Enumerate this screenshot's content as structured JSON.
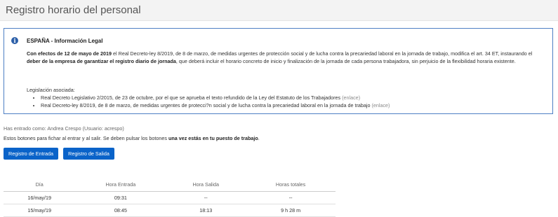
{
  "header": {
    "title": "Registro horario del personal"
  },
  "info": {
    "title": "ESPAÑA - Información Legal",
    "p_bold1": "Con efectos de 12 de mayo de 2019",
    "p_text1": " el Real Decreto-ley 8/2019, de 8 de marzo, de medidas urgentes de protección social y de lucha contra la precariedad laboral en la jornada de trabajo, modifica el art. 34 ET, instaurando el ",
    "p_bold2": "deber de la empresa de garantizar el registro diario de jornada",
    "p_text2": ", que deberá incluir el horario concreto de inicio y finalización de la jornada de cada persona trabajadora, sin perjuicio de la flexibilidad horaria existente.",
    "legislation_label": "Legislación asociada:",
    "legislation": [
      {
        "text": "Real Decreto Legislativo 2/2015, de 23 de octubre, por el que se aprueba el texto refundido de la Ley del Estatuto de los Trabajadores ",
        "link": "(enlace)"
      },
      {
        "text": "Real Decreto-ley 8/2019, de 8 de marzo, de medidas urgentes de protecci?n social y de lucha contra la precariedad laboral en la jornada de trabajo ",
        "link": "(enlace)"
      }
    ]
  },
  "user_line": "Has entrado como: Andrea Crespo  (Usuario: acrespo)",
  "hint": {
    "text": "Estos botones para fichar al entrar y al salir. Se deben pulsar los botones ",
    "bold": "una vez estás en tu puesto de trabajo",
    "end": "."
  },
  "buttons": {
    "entrada": "Registro de Entrada",
    "salida": "Registro de Salida"
  },
  "table": {
    "headers": [
      "Día",
      "Hora Entrada",
      "Hora Salida",
      "Horas totales"
    ],
    "rows": [
      [
        "16/may/19",
        "09:31",
        "--",
        "--"
      ],
      [
        "15/may/19",
        "08:45",
        "18:13",
        "9 h 28 m"
      ]
    ]
  }
}
